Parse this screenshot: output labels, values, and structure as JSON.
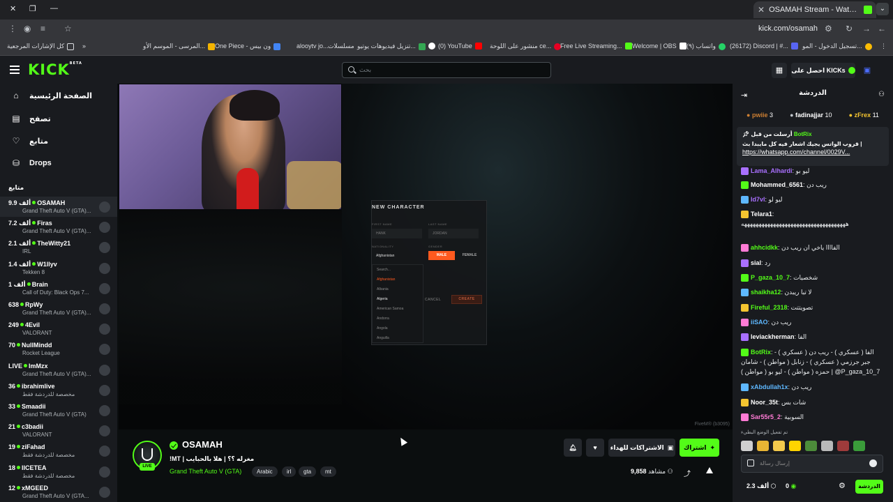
{
  "browser": {
    "tab_title": "OSAMAH Stream - Watch L",
    "url": "kick.com/osamah",
    "bookmarks": [
      "كل الإشارات المرجعية",
      "المرسى - الموسم الأو...",
      "One Piece - ون بيس",
      "alooytv jo...",
      "مسلسلات",
      "تنزيل فيديوهات يوتيو...",
      "(0) YouTube",
      "منشور على اللوحة ce...",
      "Free Live Streaming...",
      "Welcome | OBS",
      "(٩) واتساب",
      "(26172) Discord | #...",
      "تسجيل الدخول - المو..."
    ]
  },
  "header": {
    "logo": "KICK",
    "logo_badge": "BETA",
    "search_placeholder": "بحث",
    "kicks_button": "احصل على KICKs"
  },
  "sidebar": {
    "nav": [
      {
        "label": "الصفحة الرئيسية",
        "icon": "home-icon"
      },
      {
        "label": "تصفح",
        "icon": "browse-icon"
      },
      {
        "label": "متابع",
        "icon": "heart-icon"
      },
      {
        "label": "Drops",
        "icon": "drops-icon"
      }
    ],
    "section_title": "متابع",
    "channels": [
      {
        "viewers": "9.9 ألف",
        "name": "OSAMAH",
        "game": "Grand Theft Auto V (GTA)..."
      },
      {
        "viewers": "7.2 ألف",
        "name": "Firas",
        "game": "Grand Theft Auto V (GTA)..."
      },
      {
        "viewers": "2.1 ألف",
        "name": "TheWitty21",
        "game": "IRL"
      },
      {
        "viewers": "1.4 ألف",
        "name": "W1llyv",
        "game": "Tekken 8"
      },
      {
        "viewers": "1 ألف",
        "name": "Brain",
        "game": "Call of Duty: Black Ops 7..."
      },
      {
        "viewers": "638",
        "name": "RpWy",
        "game": "Grand Theft Auto V (GTA)..."
      },
      {
        "viewers": "249",
        "name": "4Evil",
        "game": "VALORANT"
      },
      {
        "viewers": "70",
        "name": "NullMindd",
        "game": "Rocket League"
      },
      {
        "viewers": "LIVE",
        "name": "lmMzx",
        "game": "Grand Theft Auto V (GTA)..."
      },
      {
        "viewers": "36",
        "name": "ibrahimlive",
        "game": "مخصصة للدردشة فقط"
      },
      {
        "viewers": "33",
        "name": "Smaadii",
        "game": "Grand Theft Auto V (GTA)"
      },
      {
        "viewers": "21",
        "name": "c3badii",
        "game": "VALORANT"
      },
      {
        "viewers": "19",
        "name": "ziFahad",
        "game": "مخصصة للدردشة فقط"
      },
      {
        "viewers": "18",
        "name": "IICETEA",
        "game": "مخصصة للدردشة فقط"
      },
      {
        "viewers": "12",
        "name": "xMGEED",
        "game": "Grand Theft Auto V (GTA..."
      }
    ]
  },
  "game_overlay": {
    "title": "NEW CHARACTER",
    "first_name_label": "FIRST NAME",
    "last_name_label": "LAST NAME",
    "first_name": "HANK",
    "last_name": "JORDAN",
    "nationality_label": "NATIONALITY",
    "gender_label": "GENDER",
    "nationality": "Afghanistan",
    "male": "MALE",
    "female": "FEMALE",
    "search_placeholder": "Search...",
    "countries": [
      "Afghanistan",
      "Albania",
      "Algeria",
      "American Samoa",
      "Andorra",
      "Angola",
      "Anguilla"
    ],
    "cancel": "CANCEL",
    "create": "CREATE",
    "watermark": "FiveM® (b3095)"
  },
  "stream": {
    "live_badge": "LIVE",
    "streamer": "OSAMAH",
    "title": "!MT | مغرله ؟؟ | هلا بالحبايب",
    "category": "Grand Theft Auto V (GTA)",
    "tags": [
      "Arabic",
      "irl",
      "gta",
      "mt"
    ],
    "viewers_label": "مشاهد",
    "viewers": "9,858",
    "subscribe": "اشتراك",
    "gift_subs": "الاشتراكات للهداء"
  },
  "chat": {
    "title": "الدردشة",
    "leaderboard": [
      {
        "name": "pwiie",
        "score": "3"
      },
      {
        "name": "fadinajjar",
        "score": "10"
      },
      {
        "name": "zFrex",
        "score": "11"
      }
    ],
    "pinned": {
      "from": "BotRix",
      "header": "أرسلت من قبل",
      "text": "قروب الواتس يجيك اشعار فيه كل مايبدا بث |",
      "link": "https://whatsapp.com/channel/0029V..."
    },
    "messages": [
      {
        "user": "Lama_Alhardi",
        "text": "ليو بو",
        "color": "#a970ff"
      },
      {
        "user": "Mohammed_6561",
        "text": "ريب دن",
        "color": "#ffffff"
      },
      {
        "user": "Id7vl",
        "text": "ليو لو",
        "color": "#a970ff"
      },
      {
        "user": "Telara1",
        "text": "ههههههههههههههههههههههههههههههههههههه",
        "color": "#ffffff"
      },
      {
        "user": "ahhcidkk",
        "text": "الفاااا ياخي ان ريب دن",
        "color": "#53fc18"
      },
      {
        "user": "sial",
        "text": "رد",
        "color": "#ffffff"
      },
      {
        "user": "P_gaza_10_7",
        "text": "شخصيات",
        "color": "#53fc18"
      },
      {
        "user": "shaikha12",
        "text": "لا تبا ريبدن",
        "color": "#53fc18"
      },
      {
        "user": "Fireful_2318",
        "text": "تصويتتت",
        "color": "#53fc18"
      },
      {
        "user": "iiSAO",
        "text": "ريب دن",
        "color": "#5eb8ff"
      },
      {
        "user": "leviackherman",
        "text": "الفا",
        "color": "#ffffff"
      },
      {
        "user": "BotRix",
        "text": "الفا ( عسكري ) - ريب دن ( عسكري ) - جبر جرزمي ( عسكري ) - زنابل ( مواطن ) - شامان حمزه ( مواطن ) - ليو بو ( مواطن ) | @P_gaza_10_7",
        "color": "#53fc18"
      },
      {
        "user": "xAbdullah1x",
        "text": "ريب دن",
        "color": "#5eb8ff"
      },
      {
        "user": "Noor_35t",
        "text": "شات بس",
        "color": "#ffffff"
      },
      {
        "user": "Sar55r5_2",
        "text": "السوبية",
        "color": "#ff7bd5"
      }
    ],
    "mode_notice": "تم تفعيل الوضع البطيء",
    "input_placeholder": "إرسال رسالة",
    "kicks": "2.3 ألف",
    "zero": "0",
    "send": "الدردشة"
  },
  "colors": {
    "accent": "#53fc18",
    "bg": "#0b0e0f",
    "panel": "#191b1f"
  }
}
